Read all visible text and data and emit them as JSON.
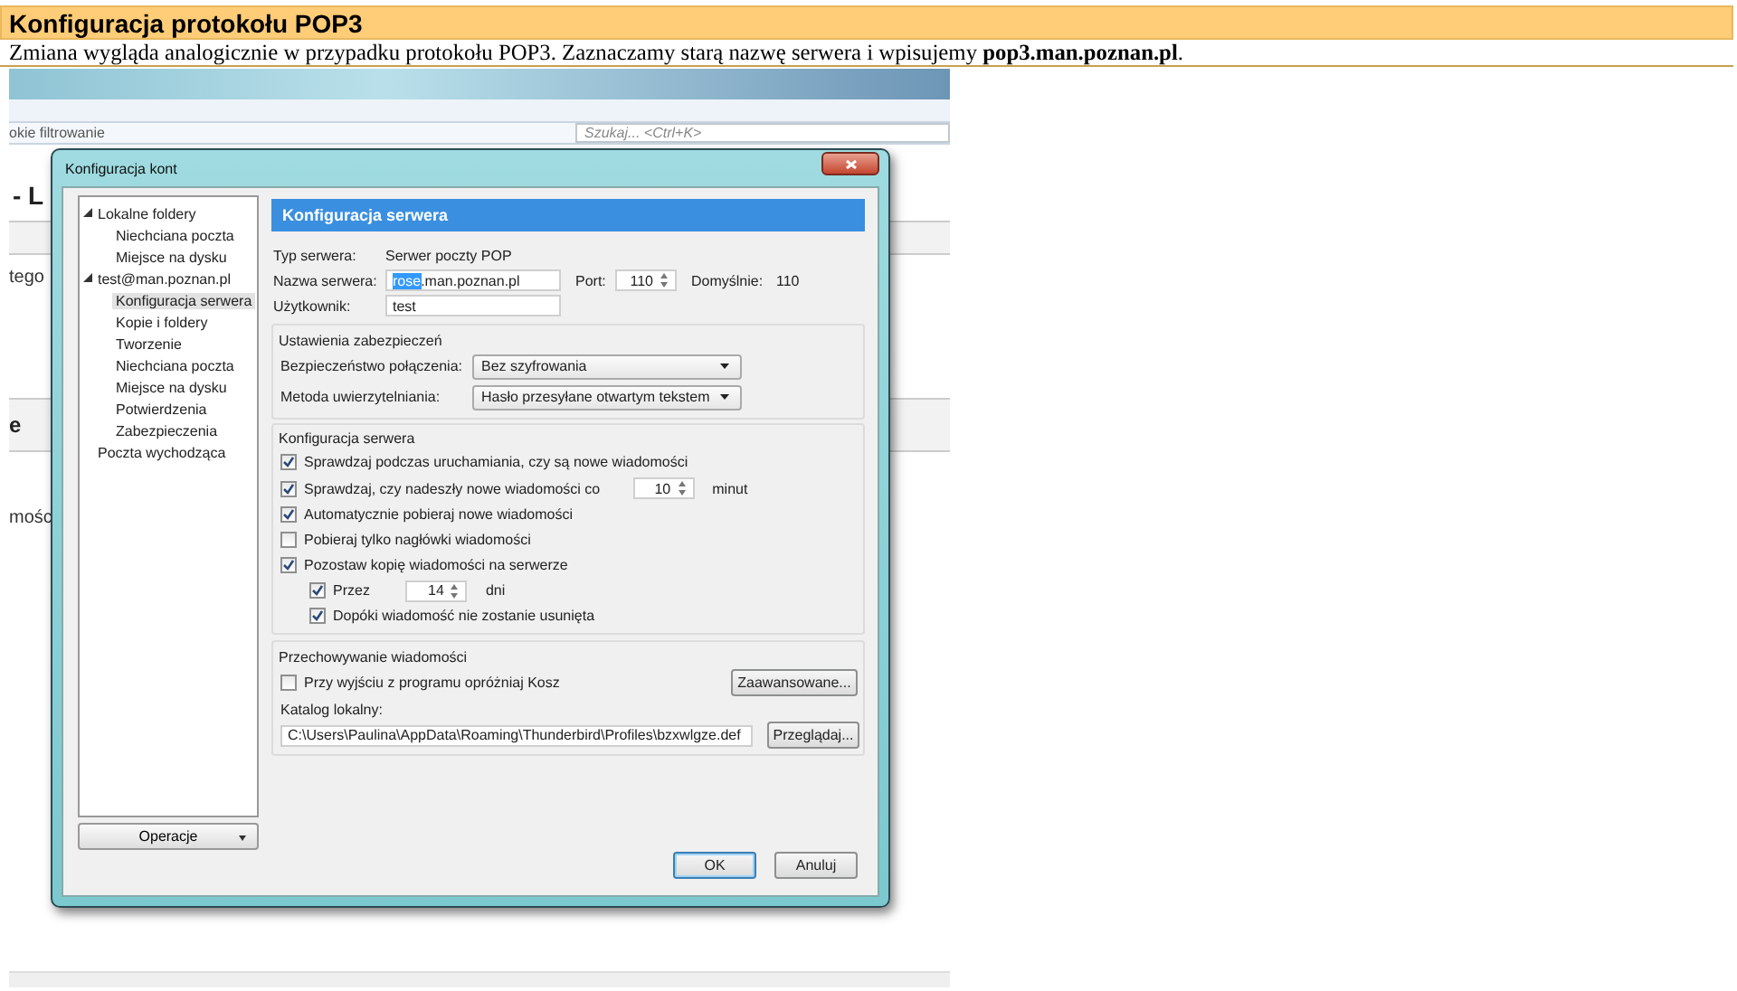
{
  "header": {
    "title": "Konfiguracja protokołu POP3",
    "text": "Zmiana wygląda analogicznie w przypadku protokołu POP3. Zaznaczamy starą nazwę serwera i wpisujemy **pop3.man.poznan.pl**."
  },
  "background_app": {
    "filter_label": "okie filtrowanie",
    "search": {
      "placeholder": "Szukaj... <Ctrl+K>"
    },
    "fragments": [
      {
        "kind": "heading",
        "text": "- L"
      },
      {
        "kind": "text",
        "text": "tego"
      },
      {
        "kind": "band",
        "text": "e"
      },
      {
        "kind": "text",
        "text": "mośc"
      }
    ]
  },
  "dialog": {
    "title": "Konfiguracja kont",
    "tree": [
      {
        "label": "Lokalne foldery",
        "expanded": true,
        "selected": false,
        "children": [
          {
            "label": "Niechciana poczta",
            "selected": false
          },
          {
            "label": "Miejsce na dysku",
            "selected": false
          }
        ]
      },
      {
        "label": "test@man.poznan.pl",
        "expanded": true,
        "selected": false,
        "children": [
          {
            "label": "Konfiguracja serwera",
            "selected": true
          },
          {
            "label": "Kopie i foldery",
            "selected": false
          },
          {
            "label": "Tworzenie",
            "selected": false
          },
          {
            "label": "Niechciana poczta",
            "selected": false
          },
          {
            "label": "Miejsce na dysku",
            "selected": false
          },
          {
            "label": "Potwierdzenia",
            "selected": false
          },
          {
            "label": "Zabezpieczenia",
            "selected": false
          }
        ]
      },
      {
        "label": "Poczta wychodząca",
        "selected": false
      }
    ],
    "operations_button": "Operacje",
    "panel": {
      "title": "Konfiguracja serwera",
      "server_type": {
        "label": "Typ serwera:",
        "value": "Serwer poczty POP"
      },
      "server_name": {
        "label": "Nazwa serwera:",
        "selected_part": "rose",
        "rest": ".man.poznan.pl"
      },
      "port": {
        "label": "Port:",
        "value": "110"
      },
      "default_port": {
        "label": "Domyślnie:",
        "value": "110"
      },
      "user": {
        "label": "Użytkownik:",
        "value": "test"
      },
      "security": {
        "title": "Ustawienia zabezpieczeń",
        "rows": [
          {
            "label": "Bezpieczeństwo połączenia:",
            "value": "Bez szyfrowania"
          },
          {
            "label": "Metoda uwierzytelniania:",
            "value": "Hasło przesyłane otwartym tekstem"
          }
        ]
      },
      "server_settings": {
        "title": "Konfiguracja serwera",
        "options": [
          {
            "kind": "check",
            "label": "Sprawdzaj podczas uruchamiania, czy są nowe wiadomości",
            "checked": true
          },
          {
            "kind": "interval",
            "label": "Sprawdzaj, czy nadeszły nowe wiadomości co",
            "value": "10",
            "unit": "minut",
            "checked": true
          },
          {
            "kind": "check",
            "label": "Automatycznie pobieraj nowe wiadomości",
            "checked": true
          },
          {
            "kind": "check",
            "label": "Pobieraj tylko nagłówki wiadomości",
            "checked": false
          },
          {
            "kind": "check",
            "label": "Pozostaw kopię wiadomości na serwerze",
            "checked": true,
            "children": [
              {
                "kind": "interval",
                "label": "Przez",
                "value": "14",
                "unit": "dni",
                "checked": true
              },
              {
                "kind": "check",
                "label": "Dopóki wiadomość nie zostanie usunięta",
                "checked": true
              }
            ]
          }
        ]
      },
      "storage": {
        "title": "Przechowywanie wiadomości",
        "empty_trash": {
          "label": "Przy wyjściu z programu opróżniaj Kosz",
          "checked": false
        },
        "advanced_button": "Zaawansowane...",
        "local_dir_label": "Katalog lokalny:",
        "local_dir": "C:\\Users\\Paulina\\AppData\\Roaming\\Thunderbird\\Profiles\\bzxwlgze.def",
        "browse_button": "Przeglądaj..."
      }
    },
    "buttons": [
      {
        "label": "OK",
        "default": true
      },
      {
        "label": "Anuluj",
        "default": false
      }
    ]
  }
}
